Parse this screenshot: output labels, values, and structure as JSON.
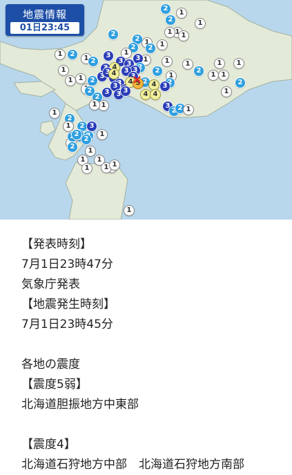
{
  "header": {
    "title": "地震情報",
    "time": "01日23:45"
  },
  "map": {
    "epicenter_icon": "x-mark-icon",
    "colors": {
      "sea": "#b9d7ec",
      "land": "#e4ead8",
      "intensity_1": "#fbfbfb",
      "intensity_2": "#2e9fe0",
      "intensity_3": "#2a3db8",
      "intensity_4": "#f1ee9c",
      "intensity_5_lower": "#f5b63c"
    },
    "markers": [
      {
        "level": "2"
      },
      {
        "level": "1"
      },
      {
        "level": "2"
      },
      {
        "level": "1"
      },
      {
        "level": "1"
      },
      {
        "level": "2"
      },
      {
        "level": "1"
      },
      {
        "level": "1"
      },
      {
        "level": "2"
      },
      {
        "level": "1"
      },
      {
        "level": "1"
      },
      {
        "level": "2"
      },
      {
        "level": "2"
      },
      {
        "level": "1"
      },
      {
        "level": "1"
      },
      {
        "level": "2"
      },
      {
        "level": "1"
      },
      {
        "level": "3"
      },
      {
        "level": "3"
      },
      {
        "level": "2"
      },
      {
        "level": "1"
      },
      {
        "level": "3"
      },
      {
        "level": "3"
      },
      {
        "level": "2"
      },
      {
        "level": "3"
      },
      {
        "level": "3"
      },
      {
        "level": "1"
      },
      {
        "level": "1"
      },
      {
        "level": "1"
      },
      {
        "level": "1"
      },
      {
        "level": "2"
      },
      {
        "level": "4"
      },
      {
        "level": "3"
      },
      {
        "level": "3"
      },
      {
        "level": "2"
      },
      {
        "level": "1"
      },
      {
        "level": "3"
      },
      {
        "level": "3"
      },
      {
        "level": "4"
      },
      {
        "level": "3"
      },
      {
        "level": "3"
      },
      {
        "level": "2"
      },
      {
        "level": "1"
      },
      {
        "level": "2"
      },
      {
        "level": "1"
      },
      {
        "level": "1"
      },
      {
        "level": "1"
      },
      {
        "level": "2"
      },
      {
        "level": "1"
      },
      {
        "level": "1"
      },
      {
        "level": "1"
      },
      {
        "level": "2"
      },
      {
        "level": "3"
      },
      {
        "level": "4"
      },
      {
        "level": "5"
      },
      {
        "level": "4"
      },
      {
        "level": "3"
      },
      {
        "level": "2"
      },
      {
        "level": "2"
      },
      {
        "level": "1"
      },
      {
        "level": "1"
      },
      {
        "level": "3"
      },
      {
        "level": "3"
      },
      {
        "level": "3"
      },
      {
        "level": "3"
      },
      {
        "level": "4"
      },
      {
        "level": "4"
      },
      {
        "level": "3"
      },
      {
        "level": "2"
      },
      {
        "level": "2"
      },
      {
        "level": "1"
      },
      {
        "level": "2"
      },
      {
        "level": "1"
      },
      {
        "level": "2"
      },
      {
        "level": "1"
      },
      {
        "level": "3"
      },
      {
        "level": "2"
      },
      {
        "level": "2"
      },
      {
        "level": "1"
      },
      {
        "level": "1"
      },
      {
        "level": "2"
      },
      {
        "level": "2"
      },
      {
        "level": "2"
      },
      {
        "level": "2"
      },
      {
        "level": "2"
      },
      {
        "level": "1"
      },
      {
        "level": "1"
      },
      {
        "level": "1"
      },
      {
        "level": "1"
      },
      {
        "level": "1"
      },
      {
        "level": "1"
      },
      {
        "level": "1"
      },
      {
        "level": "1"
      }
    ]
  },
  "report": {
    "lines": [
      "【発表時刻】",
      "7月1日23時47分",
      "気象庁発表",
      "【地震発生時刻】",
      "7月1日23時45分",
      "",
      "各地の震度",
      "【震度5弱】",
      "北海道胆振地方中東部",
      "",
      "【震度4】",
      "北海道石狩地方中部　北海道石狩地方南部"
    ]
  }
}
